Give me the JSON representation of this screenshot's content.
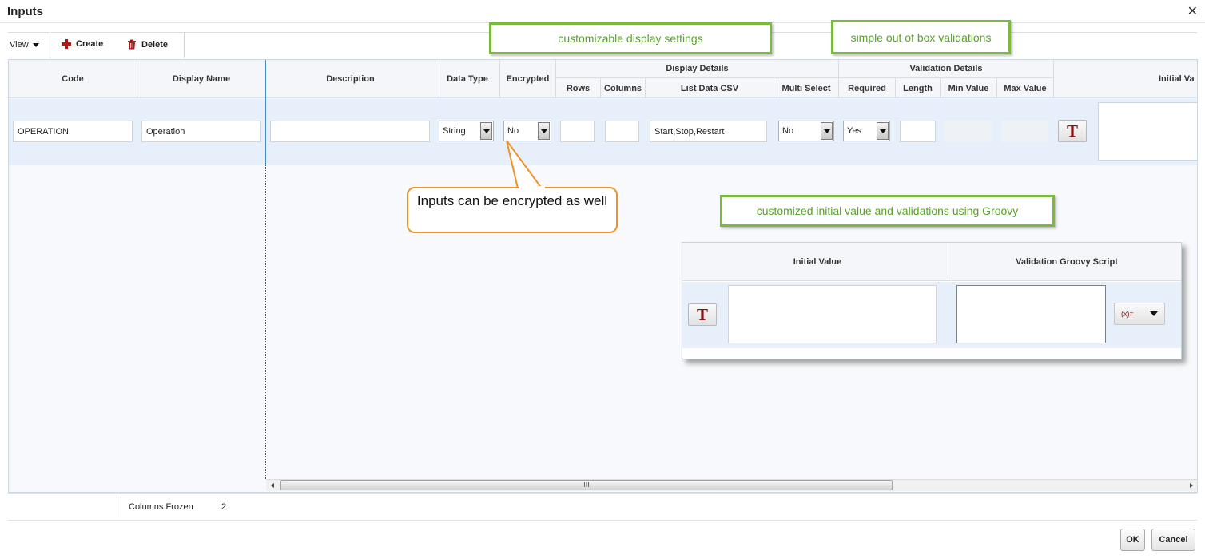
{
  "dialog": {
    "title": "Inputs",
    "close_glyph": "✕"
  },
  "toolbar": {
    "view_label": "View",
    "create_label": "Create",
    "delete_label": "Delete"
  },
  "table": {
    "columns": {
      "code": "Code",
      "display_name": "Display Name",
      "description": "Description",
      "data_type": "Data Type",
      "encrypted": "Encrypted",
      "display_details": "Display Details",
      "rows": "Rows",
      "columns": "Columns",
      "list_data_csv": "List Data CSV",
      "multi_select": "Multi Select",
      "validation_details": "Validation Details",
      "required": "Required",
      "length": "Length",
      "min_value": "Min Value",
      "max_value": "Max Value",
      "initial_value_cut": "Initial Va"
    },
    "row": {
      "code": "OPERATION",
      "display_name": "Operation",
      "description": "",
      "data_type": "String",
      "encrypted": "No",
      "rows": "",
      "columns": "",
      "list_data_csv": "Start,Stop,Restart",
      "multi_select": "No",
      "required": "Yes",
      "length": "",
      "min_value": "",
      "max_value": "",
      "initial_value_button": "T"
    },
    "scroll_thumb_grip": "III"
  },
  "status": {
    "columns_frozen_label": "Columns Frozen",
    "columns_frozen_value": "2"
  },
  "buttons": {
    "ok": "OK",
    "cancel": "Cancel"
  },
  "callouts": {
    "display_settings": "customizable display settings",
    "validations": "simple out of box validations",
    "encrypted": "Inputs can be encrypted as well",
    "groovy": "customized initial value and validations using Groovy"
  },
  "zoom_panel": {
    "initial_value": "Initial Value",
    "validation_script": "Validation Groovy Script",
    "t_button": "T",
    "expression_label": "(x)="
  },
  "colors": {
    "callout_green": "#7aba3c",
    "callout_orange": "#f0912a",
    "icon_red": "#b01818"
  }
}
